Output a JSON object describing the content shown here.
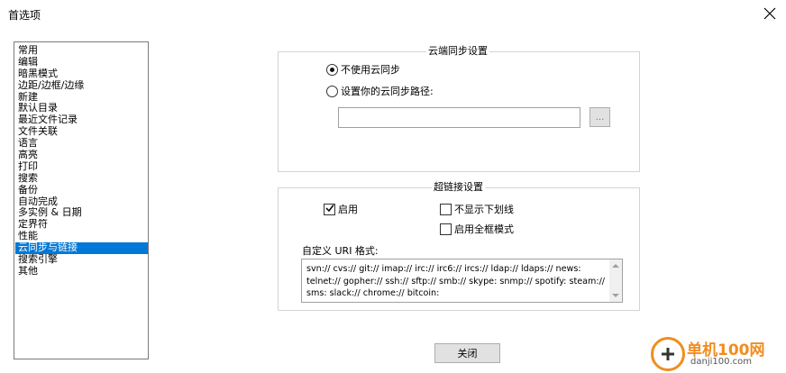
{
  "window": {
    "title": "首选项"
  },
  "sidebar": {
    "items": [
      {
        "label": "常用"
      },
      {
        "label": "编辑"
      },
      {
        "label": "暗黑模式"
      },
      {
        "label": "边距/边框/边缘"
      },
      {
        "label": "新建"
      },
      {
        "label": "默认目录"
      },
      {
        "label": "最近文件记录"
      },
      {
        "label": "文件关联"
      },
      {
        "label": "语言"
      },
      {
        "label": "高亮"
      },
      {
        "label": "打印"
      },
      {
        "label": "搜索"
      },
      {
        "label": "备份"
      },
      {
        "label": "自动完成"
      },
      {
        "label": "多实例 & 日期"
      },
      {
        "label": "定界符"
      },
      {
        "label": "性能"
      },
      {
        "label": "云同步与链接"
      },
      {
        "label": "搜索引擎"
      },
      {
        "label": "其他"
      }
    ],
    "selected": "云同步与链接"
  },
  "cloud_sync": {
    "title": "云端同步设置",
    "option_none": "不使用云同步",
    "option_path": "设置你的云同步路径:",
    "selected_option": "option_none",
    "path_value": "",
    "browse_label": "..."
  },
  "hyperlink": {
    "title": "超链接设置",
    "enable_label": "启用",
    "enable_checked": true,
    "no_underline_label": "不显示下划线",
    "no_underline_checked": false,
    "fullbox_label": "启用全框模式",
    "fullbox_checked": false,
    "uri_label": "自定义 URI 格式:",
    "uri_value": "svn:// cvs:// git:// imap:// irc:// irc6:// ircs:// ldap:// ldaps:// news: telnet:// gopher:// ssh:// sftp:// smb:// skype: snmp:// spotify: steam:// sms: slack:// chrome:// bitcoin:"
  },
  "footer": {
    "close_label": "关闭"
  },
  "watermark": {
    "name": "单机100网",
    "url": "danji100.com"
  },
  "colors": {
    "selection": "#0078d7",
    "watermark": "#f28c1e"
  }
}
